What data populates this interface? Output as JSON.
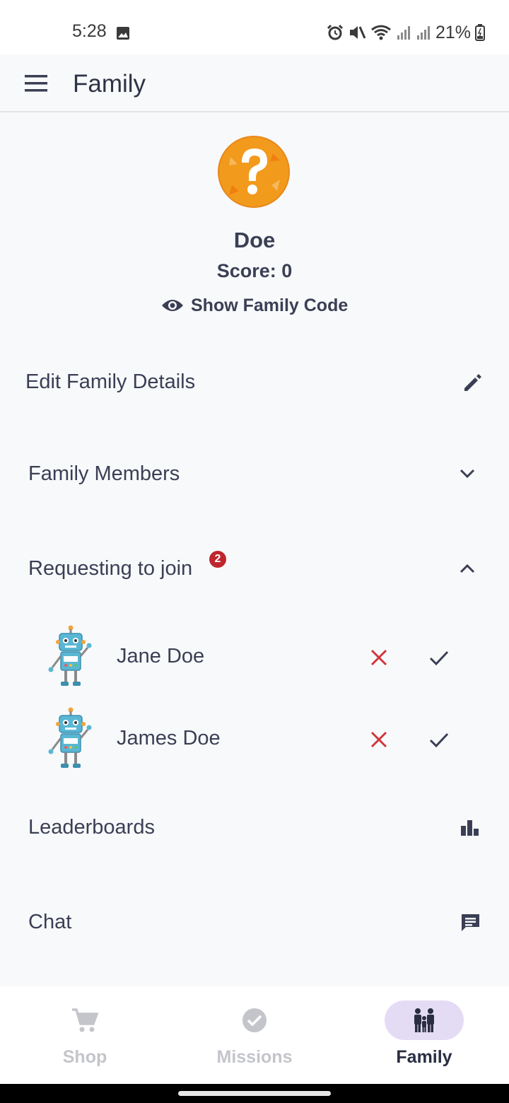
{
  "status_bar": {
    "time": "5:28",
    "battery": "21%",
    "icons": [
      "image-icon",
      "alarm-icon",
      "mute-icon",
      "wifi-icon",
      "signal-icon",
      "signal-icon",
      "battery-icon"
    ]
  },
  "app_bar": {
    "title": "Family",
    "menu_icon": "menu-icon"
  },
  "family": {
    "avatar_icon": "question-mark-badge",
    "name": "Doe",
    "score": "Score: 0",
    "show_code_label": "Show Family Code"
  },
  "rows": {
    "edit_details": "Edit Family Details",
    "members": "Family Members",
    "requesting": "Requesting to join",
    "requesting_badge": "2",
    "leaderboards": "Leaderboards",
    "chat": "Chat"
  },
  "requests": [
    {
      "name": "Jane Doe"
    },
    {
      "name": "James Doe"
    }
  ],
  "bottom_nav": {
    "shop": "Shop",
    "missions": "Missions",
    "family": "Family",
    "active": "Family"
  },
  "colors": {
    "accent": "#e4dcf5",
    "reject": "#d0363b",
    "badge": "#c0262d",
    "text": "#3b3f55"
  }
}
